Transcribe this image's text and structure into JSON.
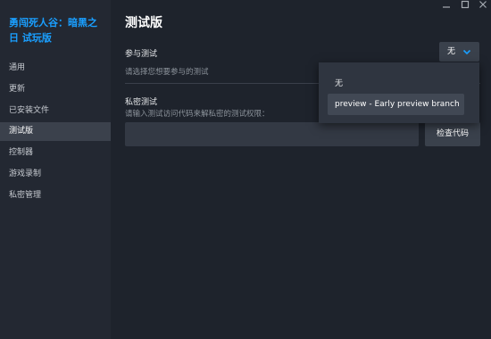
{
  "sidebar": {
    "game_title": "勇闯死人谷：暗黑之日 试玩版",
    "items": [
      {
        "label": "通用"
      },
      {
        "label": "更新"
      },
      {
        "label": "已安装文件"
      },
      {
        "label": "测试版",
        "active": true
      },
      {
        "label": "控制器"
      },
      {
        "label": "游戏录制"
      },
      {
        "label": "私密管理"
      }
    ]
  },
  "window_controls": {
    "minimize_icon": "minimize-icon",
    "maximize_icon": "maximize-icon",
    "close_icon": "close-icon"
  },
  "main": {
    "title": "测试版",
    "participate": {
      "label": "参与测试",
      "description": "请选择您想要参与的测试",
      "selected": "无"
    },
    "dropdown": {
      "options": [
        "无",
        "preview - Early preview branch"
      ],
      "hovered_index": 1
    },
    "private": {
      "label": "私密测试",
      "description": "请输入测试访问代码来解私密的测试权限：",
      "input_value": "",
      "check_button": "检查代码"
    }
  },
  "colors": {
    "accent": "#1a9fff",
    "background": "#1e232c",
    "sidebar": "#232832",
    "active_item": "#3b414c"
  }
}
